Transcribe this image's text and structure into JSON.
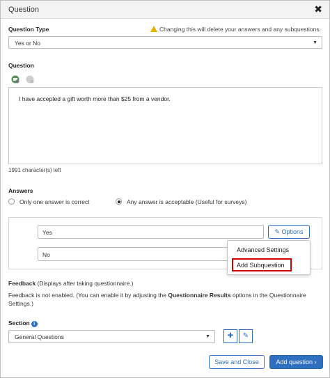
{
  "dialog": {
    "title": "Question",
    "close_glyph": "✖"
  },
  "question_type": {
    "label": "Question Type",
    "warning": "Changing this will delete your answers and any subquestions.",
    "value": "Yes or No"
  },
  "question": {
    "label": "Question",
    "text": "I have accepted a gift worth more than $25 from a vendor.",
    "chars_left": "1991 character(s) left"
  },
  "answers": {
    "label": "Answers",
    "mode_only_one": "Only one answer is correct",
    "mode_any": "Any answer is acceptable (Useful for surveys)",
    "mode_selected": "any",
    "items": [
      {
        "value": "Yes"
      },
      {
        "value": "No"
      }
    ],
    "options_label": "Options",
    "menu": {
      "advanced": "Advanced Settings",
      "add_subquestion": "Add Subquestion"
    }
  },
  "feedback": {
    "label": "Feedback",
    "label_note": "(Displays after taking questionnaire.)",
    "text_part1": "Feedback is not enabled. (You can enable it by adjusting the ",
    "text_bold": "Questionnaire Results",
    "text_part2": " options in the Questionnaire",
    "text_line2": "Settings.)"
  },
  "section": {
    "label": "Section",
    "value": "General Questions"
  },
  "footer": {
    "save_close": "Save and Close",
    "add_question": "Add question ›"
  },
  "colors": {
    "accent": "#2f6fc0",
    "highlight": "#d40000",
    "warning": "#e6b400"
  }
}
